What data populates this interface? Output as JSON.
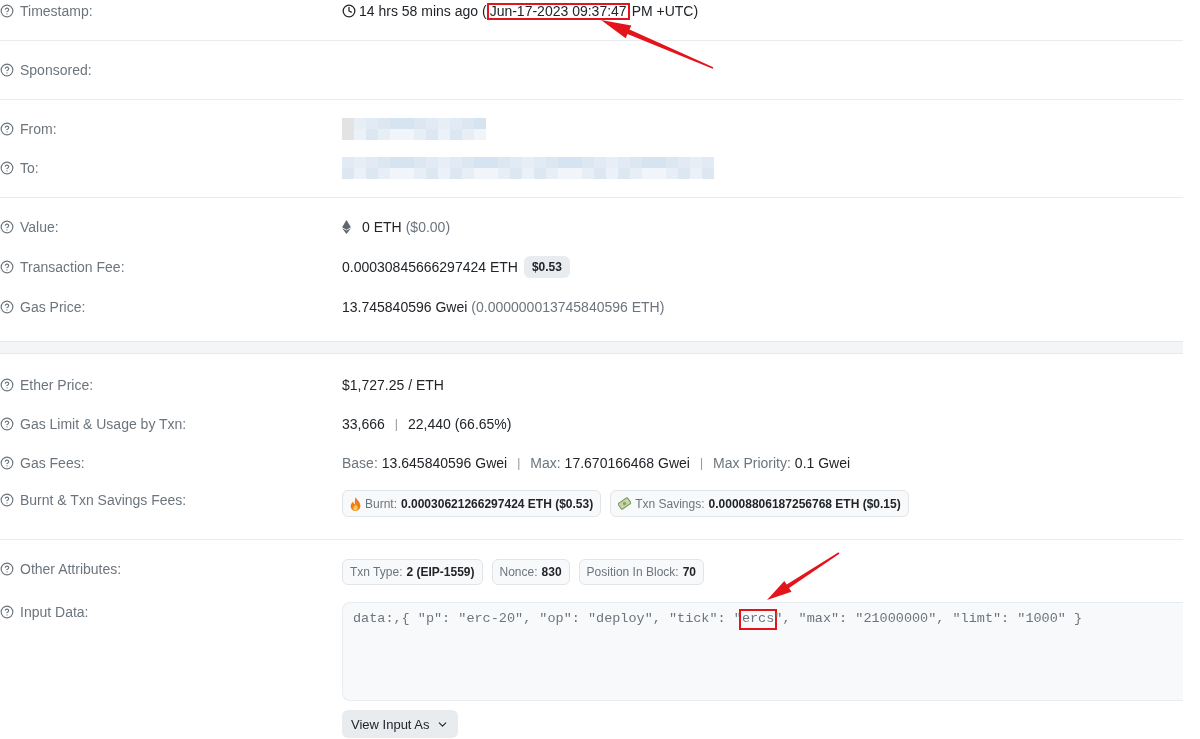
{
  "sections": [
    {
      "groups": [
        {
          "rows": [
            {
              "label": "Timestamp:",
              "kind": "timestamp",
              "segments": [
                {
                  "text": "14 hrs 58 mins ago (",
                  "highlighted": false,
                  "arrow": false
                },
                {
                  "text": "Jun-17-2023 09:37:47",
                  "highlighted": true,
                  "arrow": true
                },
                {
                  "text": "PM +UTC)",
                  "highlighted": false,
                  "arrow": false
                }
              ]
            }
          ]
        },
        {
          "rows": [
            {
              "label": "Sponsored:",
              "kind": "blank"
            }
          ]
        },
        {
          "rows": [
            {
              "label": "From:",
              "kind": "blurred",
              "wide": false
            },
            {
              "label": "To:",
              "kind": "blurred",
              "wide": true
            }
          ]
        },
        {
          "rows": [
            {
              "label": "Value:",
              "kind": "ether",
              "parts": [
                {
                  "text": "0 ETH",
                  "kind": "plain"
                },
                {
                  "text": "($0.00)",
                  "kind": "muted"
                }
              ]
            },
            {
              "label": "Transaction Fee:",
              "kind": "parts",
              "parts": [
                {
                  "text": "0.00030845666297424 ETH",
                  "kind": "plain"
                },
                {
                  "text": "$0.53",
                  "kind": "badge"
                }
              ]
            },
            {
              "label": "Gas Price:",
              "kind": "parts",
              "parts": [
                {
                  "text": "13.745840596 Gwei",
                  "kind": "plain"
                },
                {
                  "text": "(0.000000013745840596 ETH)",
                  "kind": "muted"
                }
              ]
            }
          ]
        }
      ]
    },
    {
      "groups": [
        {
          "rows": [
            {
              "label": "Ether Price:",
              "kind": "parts",
              "parts": [
                {
                  "text": "$1,727.25 / ETH",
                  "kind": "plain"
                }
              ]
            },
            {
              "label": "Gas Limit & Usage by Txn:",
              "kind": "parts",
              "parts": [
                {
                  "text": "33,666",
                  "kind": "plain"
                },
                {
                  "text": "|",
                  "kind": "separator"
                },
                {
                  "text": "22,440 (66.65%)",
                  "kind": "plain"
                }
              ]
            },
            {
              "label": "Gas Fees:",
              "kind": "parts",
              "parts": [
                {
                  "text": "Base:",
                  "kind": "muted"
                },
                {
                  "text": "13.645840596 Gwei",
                  "kind": "plain"
                },
                {
                  "text": "|",
                  "kind": "separator"
                },
                {
                  "text": "Max:",
                  "kind": "muted"
                },
                {
                  "text": "17.670166468 Gwei",
                  "kind": "plain"
                },
                {
                  "text": "|",
                  "kind": "separator"
                },
                {
                  "text": "Max Priority:",
                  "kind": "muted"
                },
                {
                  "text": "0.1 Gwei",
                  "kind": "plain"
                }
              ]
            },
            {
              "label": "Burnt & Txn Savings Fees:",
              "kind": "fees",
              "chips": [
                {
                  "kind": "burnt",
                  "label": "Burnt:",
                  "value": "0.00030621266297424 ETH ($0.53)"
                },
                {
                  "kind": "savings",
                  "label": "Txn Savings:",
                  "value": "0.00008806187256768 ETH ($0.15)"
                }
              ]
            }
          ]
        },
        {
          "rows": [
            {
              "label": "Other Attributes:",
              "kind": "attributes",
              "chips": [
                {
                  "label": "Txn Type:",
                  "value": "2 (EIP-1559)"
                },
                {
                  "label": "Nonce:",
                  "value": "830"
                },
                {
                  "label": "Position In Block:",
                  "value": "70"
                }
              ]
            },
            {
              "label": "Input Data:",
              "kind": "input",
              "segments": [
                {
                  "text": "data:,{ \"p\": \"erc-20\", \"op\": \"deploy\", \"tick\": \"",
                  "highlighted": false,
                  "arrow": false
                },
                {
                  "text": "ercs",
                  "highlighted": true,
                  "arrow": true
                },
                {
                  "text": "\", \"max\": \"21000000\", \"limt\": \"1000\" }",
                  "highlighted": false,
                  "arrow": false
                }
              ],
              "button": "View Input As"
            }
          ]
        }
      ]
    }
  ]
}
